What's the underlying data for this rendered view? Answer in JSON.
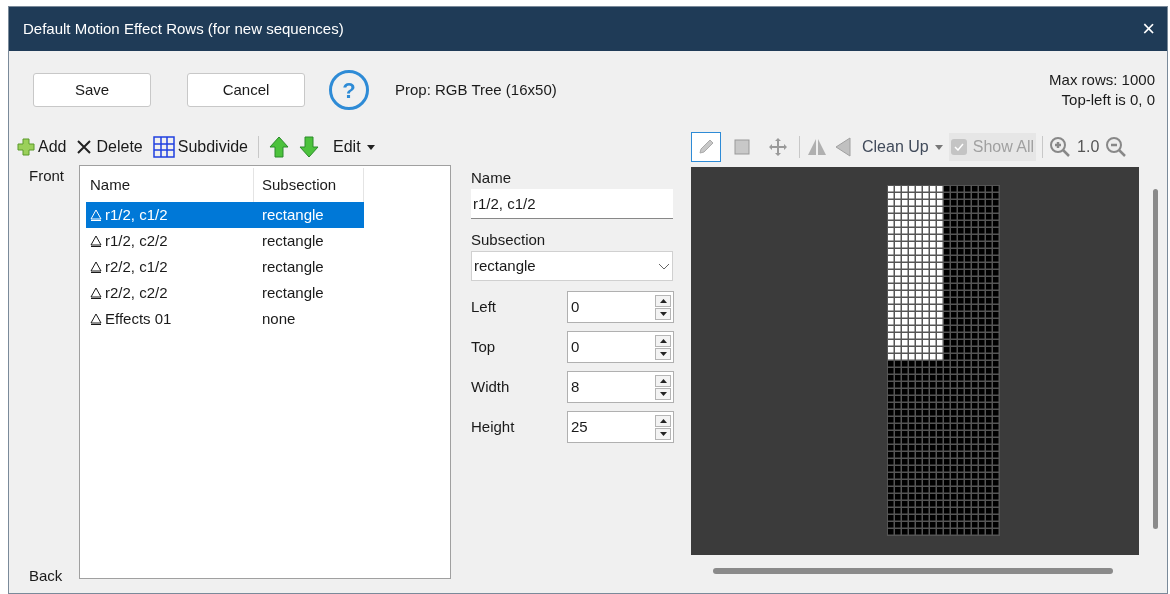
{
  "window": {
    "title": "Default Motion Effect Rows (for new sequences)",
    "close": "×"
  },
  "top_bar": {
    "buttons": [
      "Save",
      "Cancel"
    ],
    "help": "?",
    "prop": "Prop: RGB Tree (16x50)",
    "info": [
      "Max rows: 1000",
      "Top-left is 0, 0"
    ]
  },
  "left_toolbar": {
    "add": "Add",
    "delete": "Delete",
    "subdivide": "Subdivide",
    "edit": "Edit"
  },
  "side_labels": {
    "front": "Front",
    "back": "Back"
  },
  "table": {
    "columns": [
      "Name",
      "Subsection"
    ],
    "rows": [
      {
        "name": "r1/2, c1/2",
        "subsection": "rectangle",
        "selected": true
      },
      {
        "name": "r1/2, c2/2",
        "subsection": "rectangle",
        "selected": false
      },
      {
        "name": "r2/2, c1/2",
        "subsection": "rectangle",
        "selected": false
      },
      {
        "name": "r2/2, c2/2",
        "subsection": "rectangle",
        "selected": false
      },
      {
        "name": "Effects 01",
        "subsection": "none",
        "selected": false
      }
    ]
  },
  "form": {
    "name_label": "Name",
    "name_value": "r1/2, c1/2",
    "subsection_label": "Subsection",
    "subsection_value": "rectangle",
    "spinners": [
      {
        "label": "Left",
        "value": "0"
      },
      {
        "label": "Top",
        "value": "0"
      },
      {
        "label": "Width",
        "value": "8"
      },
      {
        "label": "Height",
        "value": "25"
      }
    ]
  },
  "canvas_toolbar": {
    "tools": [
      {
        "kind": "pencil",
        "selected": true
      },
      {
        "kind": "square",
        "selected": false
      },
      {
        "kind": "move",
        "selected": false
      }
    ],
    "clean_up": "Clean Up",
    "show_all": {
      "label": "Show All",
      "checked": true,
      "disabled": true
    },
    "zoom": "1.0"
  }
}
